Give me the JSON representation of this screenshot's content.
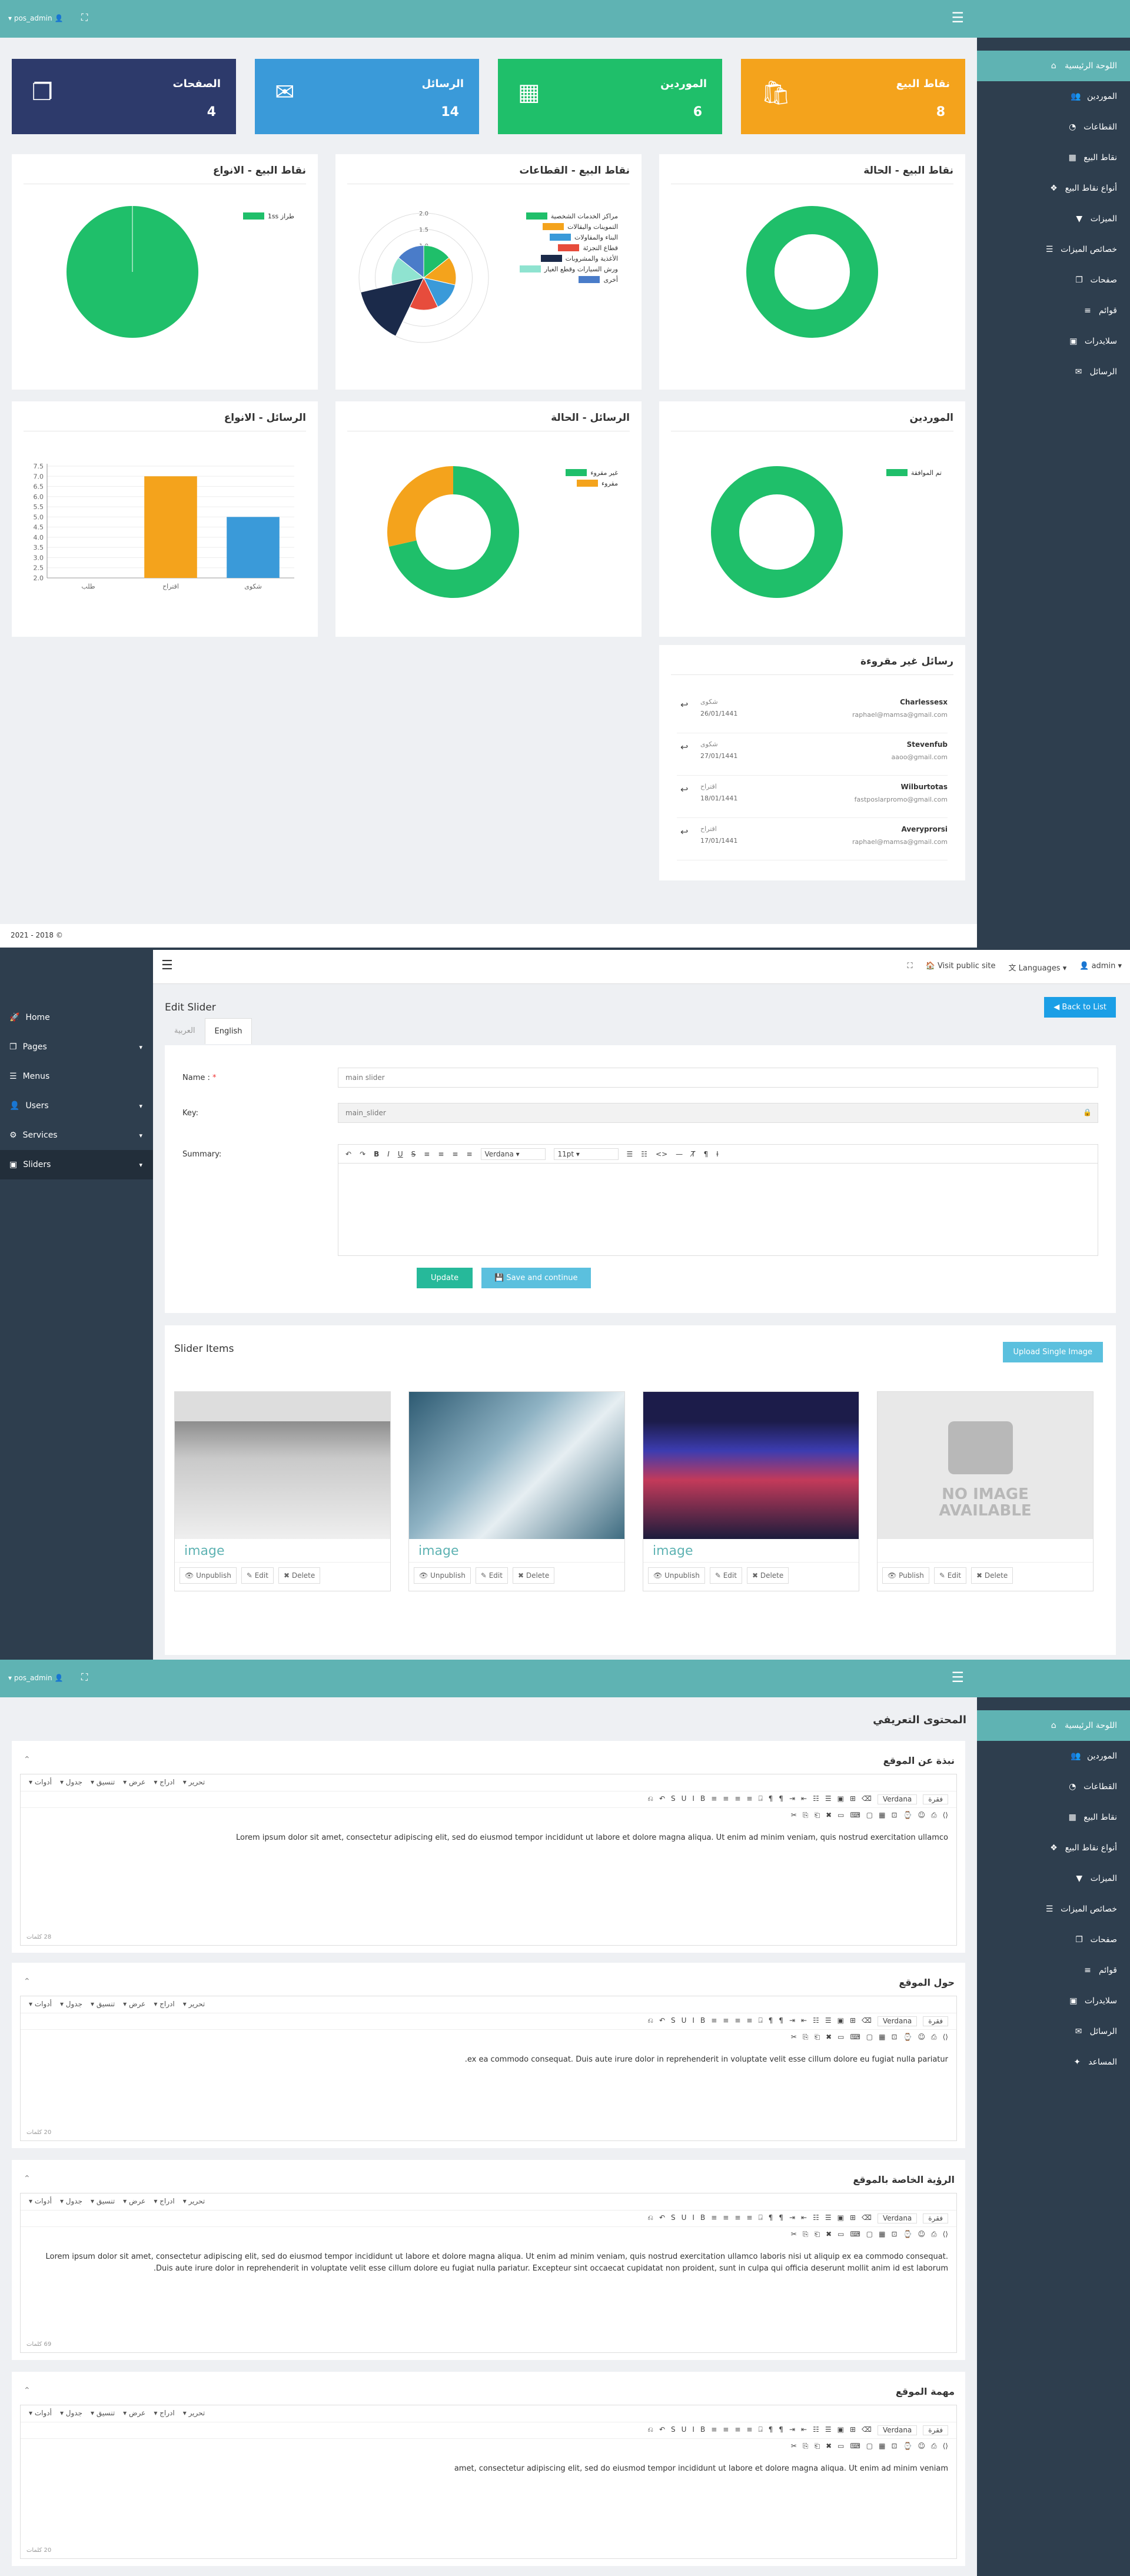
{
  "dashboard": {
    "user": "pos_admin",
    "sidebar": [
      {
        "label": "اللوحة الرئيسية",
        "icon": "home-icon"
      },
      {
        "label": "الموردين",
        "icon": "users-icon"
      },
      {
        "label": "القطاعات",
        "icon": "pie-icon"
      },
      {
        "label": "نقاط البيع",
        "icon": "store-icon"
      },
      {
        "label": "أنواع نقاط البيع",
        "icon": "cubes-icon"
      },
      {
        "label": "الميزات",
        "icon": "filter-icon"
      },
      {
        "label": "خصائص الميزات",
        "icon": "list-icon"
      },
      {
        "label": "صفحات",
        "icon": "files-icon"
      },
      {
        "label": "قوائم",
        "icon": "menu-icon"
      },
      {
        "label": "سلايدرات",
        "icon": "image-icon"
      },
      {
        "label": "الرسائل",
        "icon": "envelope-icon"
      }
    ],
    "stats": [
      {
        "label": "الصفحات",
        "value": "4",
        "color": "#2d3a6b"
      },
      {
        "label": "الرسائل",
        "value": "14",
        "color": "#3a9ad9"
      },
      {
        "label": "الموردين",
        "value": "6",
        "color": "#1fbf6a"
      },
      {
        "label": "نقاط البيع",
        "value": "8",
        "color": "#f4a31c"
      }
    ],
    "panels": {
      "pos_types": {
        "title": "نقاط البيع - الانواع",
        "legend": [
          "طراز 1ss"
        ]
      },
      "pos_sectors": {
        "title": "نقاط البيع - القطاعات",
        "legend": [
          "مراكز الخدمات الشخصية",
          "التموينات والبقالات",
          "البناء والمقاولات",
          "قطاع التجزئة",
          "الأغذية والمشروبات",
          "ورش السيارات وقطع الغيار",
          "أخرى"
        ],
        "ticks": [
          "2.0",
          "1.5",
          "1.0",
          "0.5"
        ]
      },
      "pos_status": {
        "title": "نقاط البيع - الحالة"
      },
      "msg_types": {
        "title": "الرسائل - الانواع",
        "categories": [
          "طلب",
          "اقتراح",
          "شكوى"
        ],
        "yticks": [
          "7.5",
          "7.0",
          "6.5",
          "6.0",
          "5.5",
          "5.0",
          "4.5",
          "4.0",
          "3.5",
          "3.0",
          "2.5",
          "2.0"
        ]
      },
      "msg_status": {
        "title": "الرسائل - الحالة",
        "legend": [
          "غير مقروء",
          "مقروء"
        ]
      },
      "suppliers": {
        "title": "الموردين",
        "legend": [
          "تم الموافقة"
        ]
      },
      "unread": {
        "title": "رسائل غير مقروءة",
        "items": [
          {
            "name": "Charlessesx",
            "email": "raphael@mamsa@gmail.com",
            "type": "شكوى",
            "date": "26/01/1441"
          },
          {
            "name": "Stevenfub",
            "email": "aaoo@gmail.com",
            "type": "شكوى",
            "date": "27/01/1441"
          },
          {
            "name": "Wilburtotas",
            "email": "fastposlarpromo@gmail.com",
            "type": "اقتراح",
            "date": "18/01/1441"
          },
          {
            "name": "Averyprorsi",
            "email": "raphael@mamsa@gmail.com",
            "type": "اقتراح",
            "date": "17/01/1441"
          }
        ]
      }
    },
    "footer": "2021 - 2018 ©"
  },
  "chart_data": [
    {
      "type": "pie",
      "title": "نقاط البيع - الانواع",
      "labels": [
        "طراز 1ss"
      ],
      "values": [
        1
      ]
    },
    {
      "type": "pie",
      "title": "نقاط البيع - القطاعات",
      "labels": [
        "مراكز الخدمات الشخصية",
        "التموينات والبقالات",
        "البناء والمقاولات",
        "قطاع التجزئة",
        "الأغذية والمشروبات",
        "ورش السيارات وقطع الغيار",
        "أخرى"
      ],
      "values": [
        1,
        1,
        1,
        1,
        2,
        1,
        1
      ]
    },
    {
      "type": "pie",
      "title": "نقاط البيع - الحالة",
      "labels": [
        ""
      ],
      "values": [
        1
      ]
    },
    {
      "type": "bar",
      "title": "الرسائل - الانواع",
      "categories": [
        "طلب",
        "اقتراح",
        "شكوى"
      ],
      "values": [
        0,
        7,
        5
      ],
      "ylim": [
        2,
        7.5
      ]
    },
    {
      "type": "pie",
      "title": "الرسائل - الحالة",
      "labels": [
        "غير مقروء",
        "مقروء"
      ],
      "values": [
        10,
        4
      ]
    },
    {
      "type": "pie",
      "title": "الموردين",
      "labels": [
        "تم الموافقة"
      ],
      "values": [
        1
      ]
    }
  ],
  "slider_admin": {
    "sidebar": [
      "Home",
      "Pages",
      "Menus",
      "Users",
      "Services",
      "Sliders"
    ],
    "topnav": [
      "Visit public site",
      "Languages",
      "admin"
    ],
    "page_title": "Edit Slider",
    "back": "Back to List",
    "tabs": [
      "العربية",
      "English"
    ],
    "name_label": "Name :",
    "name_value": "main slider",
    "key_label": "Key:",
    "key_value": "main_slider",
    "summary_label": "Summary:",
    "font": "Verdana",
    "size": "11pt",
    "update": "Update",
    "save_continue": "Save and continue",
    "items_title": "Slider Items",
    "upload": "Upload Single Image",
    "cards": [
      {
        "caption": "image",
        "a1": "Unpublish",
        "a2": "Edit",
        "a3": "Delete"
      },
      {
        "caption": "image",
        "a1": "Unpublish",
        "a2": "Edit",
        "a3": "Delete"
      },
      {
        "caption": "image",
        "a1": "Unpublish",
        "a2": "Edit",
        "a3": "Delete"
      },
      {
        "caption": "",
        "a1": "Publish",
        "a2": "Edit",
        "a3": "Delete",
        "noimg": "NO IMAGE AVAILABLE"
      }
    ]
  },
  "intro": {
    "user": "pos_admin",
    "sidebar": [
      "اللوحة الرئيسية",
      "الموردين",
      "القطاعات",
      "نقاط البيع",
      "أنواع نقاط البيع",
      "الميزات",
      "خصائص الميزات",
      "صفحات",
      "قوائم",
      "سلايدرات",
      "الرسائل",
      "المساعد"
    ],
    "title": "المحتوى التعريفي",
    "menubar": [
      "تحرير",
      "ادراج",
      "عرض",
      "تنسيق",
      "جدول",
      "أدوات"
    ],
    "font": "Verdana",
    "para": "فقرة",
    "sections": [
      {
        "title": "نبذة عن الموقع",
        "body": "Lorem ipsum dolor sit amet, consectetur adipiscing elit, sed do eiusmod tempor incididunt ut labore et dolore magna aliqua. Ut enim ad minim veniam, quis nostrud exercitation ullamco",
        "words": "28 كلمات"
      },
      {
        "title": "حول الموقع",
        "body": "ex ea commodo consequat. Duis aute irure dolor in reprehenderit in voluptate velit esse cillum dolore eu fugiat nulla pariatur.",
        "words": "20 كلمات"
      },
      {
        "title": "الرؤية الخاصة بالموقع",
        "body": "Lorem ipsum dolor sit amet, consectetur adipiscing elit, sed do eiusmod tempor incididunt ut labore et dolore magna aliqua. Ut enim ad minim veniam, quis nostrud exercitation ullamco laboris nisi ut aliquip ex ea commodo consequat. Duis aute irure dolor in reprehenderit in voluptate velit esse cillum dolore eu fugiat nulla pariatur. Excepteur sint occaecat cupidatat non proident, sunt in culpa qui officia deserunt mollit anim id est laborum.",
        "words": "69 كلمات"
      },
      {
        "title": "مهمة الموقع",
        "body": "amet, consectetur adipiscing elit, sed do eiusmod tempor incididunt ut labore et dolore magna aliqua. Ut enim ad minim veniam",
        "words": "20 كلمات"
      }
    ]
  }
}
